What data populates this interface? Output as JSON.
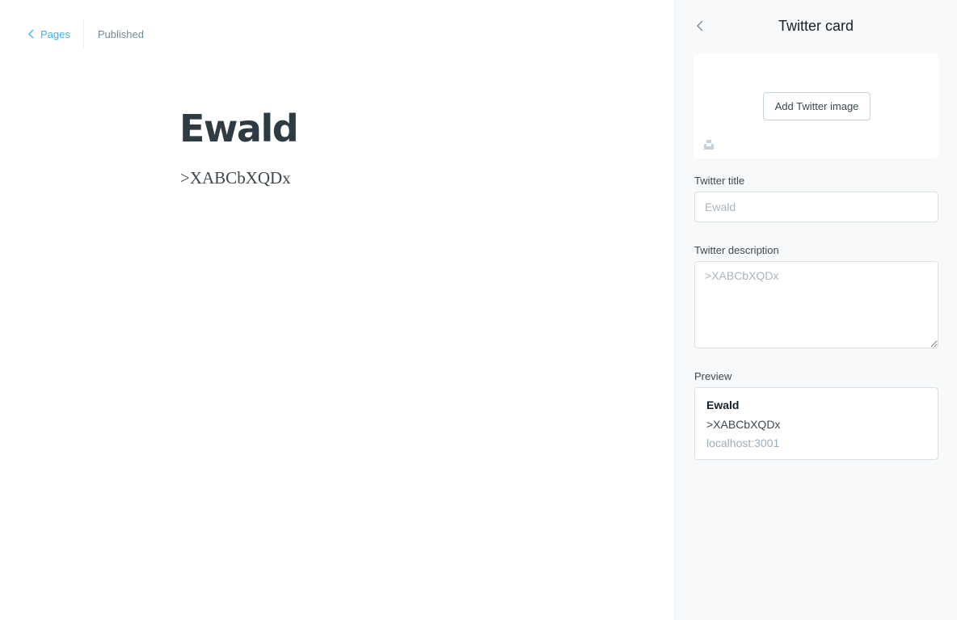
{
  "editor": {
    "back_label": "Pages",
    "status": "Published",
    "post_title": "Ewald",
    "post_body": ">XABCbXQDx"
  },
  "twitter_menu": {
    "title": "Twitter card",
    "add_image_label": "Add Twitter image",
    "title_field": {
      "label": "Twitter title",
      "value": "",
      "placeholder": "Ewald"
    },
    "description_field": {
      "label": "Twitter description",
      "value": "",
      "placeholder": ">XABCbXQDx"
    },
    "preview": {
      "label": "Preview",
      "title": "Ewald",
      "description": ">XABCbXQDx",
      "url": "localhost:3001"
    }
  },
  "icons": {
    "back": "chevron-left-icon",
    "menu_back": "chevron-left-icon",
    "unsplash": "unsplash-icon"
  },
  "colors": {
    "accent": "#3eb0ef",
    "menu_background": "#f8f9fa"
  }
}
